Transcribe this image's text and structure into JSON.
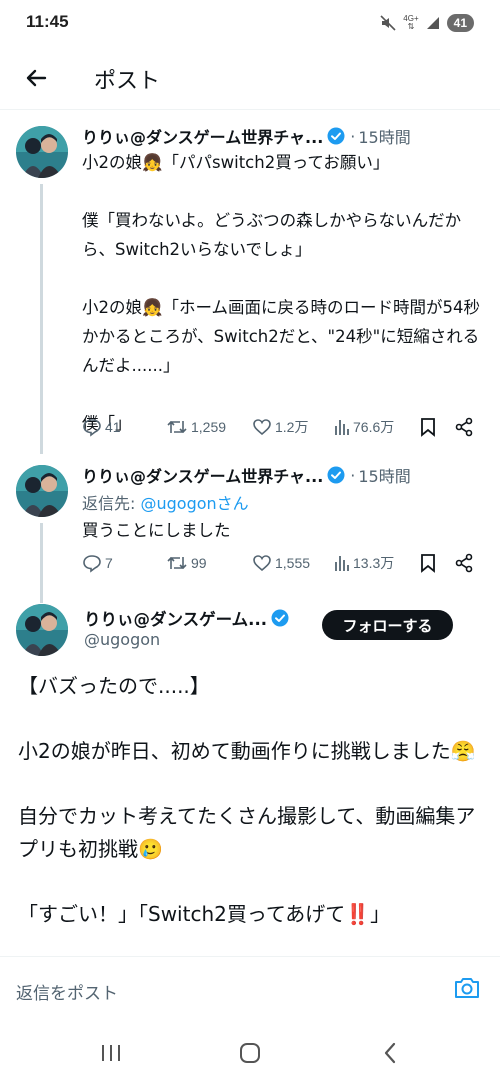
{
  "status_bar": {
    "time": "11:45",
    "network": "4G+",
    "battery": "41",
    "icons": [
      "mute-icon",
      "signal-icon",
      "wifi-icon",
      "battery-icon"
    ]
  },
  "header": {
    "title": "ポスト",
    "back_icon": "arrow-left-icon"
  },
  "colors": {
    "accent": "#1d9bf0",
    "text": "#0f1419",
    "muted": "#536471",
    "thread_line": "#cfd9de",
    "follow_button": "#0f1419"
  },
  "thread": [
    {
      "name": "りりぃ@ダンスゲーム世界チャ...",
      "time": "15時間",
      "body": "小2の娘👧「パパswitch2買ってお願い」\n\n僕「買わないよ。どうぶつの森しかやらないんだから、Switch2いらないでしょ」\n\n小2の娘👧「ホーム画面に戻る時のロード時間が54秒かかるところが、Switch2だと、\"24秒\"に短縮されるんだよ......」\n\n僕「」",
      "replies": "41",
      "reposts": "1,259",
      "likes": "1.2万",
      "views": "76.6万"
    },
    {
      "name": "りりぃ@ダンスゲーム世界チャ...",
      "time": "15時間",
      "reply_prefix": "返信先: ",
      "reply_handle": "@ugogonさん",
      "body": "買うことにしました",
      "replies": "7",
      "reposts": "99",
      "likes": "1,555",
      "views": "13.3万"
    }
  ],
  "main_post": {
    "name": "りりぃ@ダンスゲーム...",
    "handle": "@ugogon",
    "follow_label": "フォローする",
    "body": "【バズったので.....】\n\n小2の娘が昨日、初めて動画作りに挑戦しました😤\n\n自分でカット考えてたくさん撮影して、動画編集アプリも初挑戦🥲\n\n「すごい！」「Switch2買ってあげて‼️」"
  },
  "reply_bar": {
    "placeholder": "返信をポスト",
    "camera_icon": "camera-icon"
  },
  "nav_bar": {
    "icons": [
      "recent-apps-icon",
      "home-icon",
      "back-icon"
    ]
  }
}
